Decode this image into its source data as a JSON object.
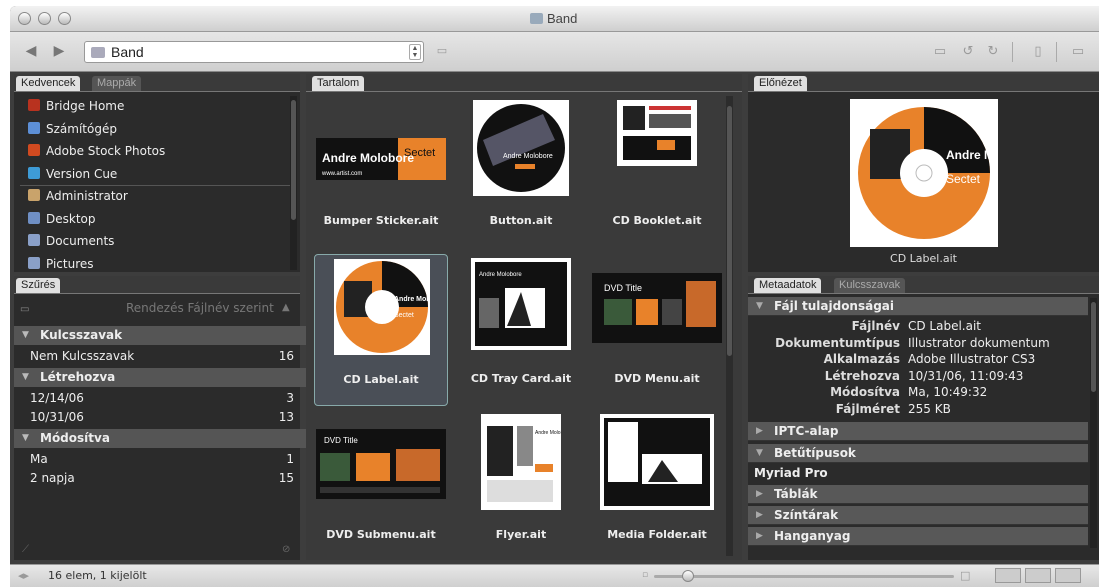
{
  "window": {
    "title": "Band"
  },
  "toolbar": {
    "path": "Band"
  },
  "left": {
    "tabs": [
      "Kedvencek",
      "Mappák"
    ],
    "favorites": [
      {
        "label": "Bridge Home",
        "icon": "bridge-icon",
        "color": "#b8321f"
      },
      {
        "label": "Számítógép",
        "icon": "computer-icon",
        "color": "#5d8fd6"
      },
      {
        "label": "Adobe Stock Photos",
        "icon": "stock-photos-icon",
        "color": "#d14a20"
      },
      {
        "label": "Version Cue",
        "icon": "version-cue-icon",
        "color": "#3e9bd6"
      },
      {
        "label": "Administrator",
        "icon": "user-home-icon",
        "color": "#c9a36b"
      },
      {
        "label": "Desktop",
        "icon": "desktop-icon",
        "color": "#6f8fc4"
      },
      {
        "label": "Documents",
        "icon": "documents-icon",
        "color": "#8aa0c8"
      },
      {
        "label": "Pictures",
        "icon": "pictures-icon",
        "color": "#8aa0c8"
      }
    ],
    "filter": {
      "tab": "Szűrés",
      "sort_label": "Rendezés Fájlnév szerint",
      "groups": [
        {
          "title": "Kulcsszavak",
          "items": [
            {
              "label": "Nem Kulcsszavak",
              "count": "16"
            }
          ]
        },
        {
          "title": "Létrehozva",
          "items": [
            {
              "label": "12/14/06",
              "count": "3"
            },
            {
              "label": "10/31/06",
              "count": "13"
            }
          ]
        },
        {
          "title": "Módosítva",
          "items": [
            {
              "label": "Ma",
              "count": "1"
            },
            {
              "label": "2 napja",
              "count": "15"
            }
          ]
        }
      ]
    }
  },
  "content": {
    "tab": "Tartalom",
    "items": [
      {
        "name": "Bumper Sticker.ait",
        "thumb_text": "Andre Molobore",
        "thumb_sub": "Sectet",
        "url": "www.artist.com"
      },
      {
        "name": "Button.ait",
        "thumb_text": "Andre Molobore"
      },
      {
        "name": "CD Booklet.ait"
      },
      {
        "name": "CD Label.ait",
        "thumb_text": "Andre Molobore",
        "thumb_sub": "Sectet"
      },
      {
        "name": "CD Tray Card.ait",
        "thumb_text": "Andre Molobore"
      },
      {
        "name": "DVD Menu.ait",
        "thumb_text": "DVD Title"
      },
      {
        "name": "DVD Submenu.ait",
        "thumb_text": "DVD Title"
      },
      {
        "name": "Flyer.ait",
        "thumb_text": "Andre Molobore"
      },
      {
        "name": "Media Folder.ait"
      }
    ]
  },
  "preview": {
    "tab": "Előnézet",
    "caption": "CD Label.ait",
    "title": "Andre Molobore",
    "sub": "Sectet"
  },
  "metadata": {
    "tabs": [
      "Metaadatok",
      "Kulcsszavak"
    ],
    "file_props_title": "Fájl tulajdonságai",
    "rows": [
      {
        "key": "Fájlnév",
        "value": "CD Label.ait"
      },
      {
        "key": "Dokumentumtípus",
        "value": "Illustrator dokumentum"
      },
      {
        "key": "Alkalmazás",
        "value": "Adobe Illustrator CS3"
      },
      {
        "key": "Létrehozva",
        "value": "10/31/06, 11:09:43"
      },
      {
        "key": "Módosítva",
        "value": "Ma, 10:49:32"
      },
      {
        "key": "Fájlméret",
        "value": "255 KB"
      }
    ],
    "iptc": "IPTC-alap",
    "fonts": "Betűtípusok",
    "font_value": "Myriad Pro",
    "plates": "Táblák",
    "swatches": "Színtárak",
    "materials": "Hanganyag"
  },
  "status": {
    "text": "16 elem, 1 kijelölt"
  }
}
